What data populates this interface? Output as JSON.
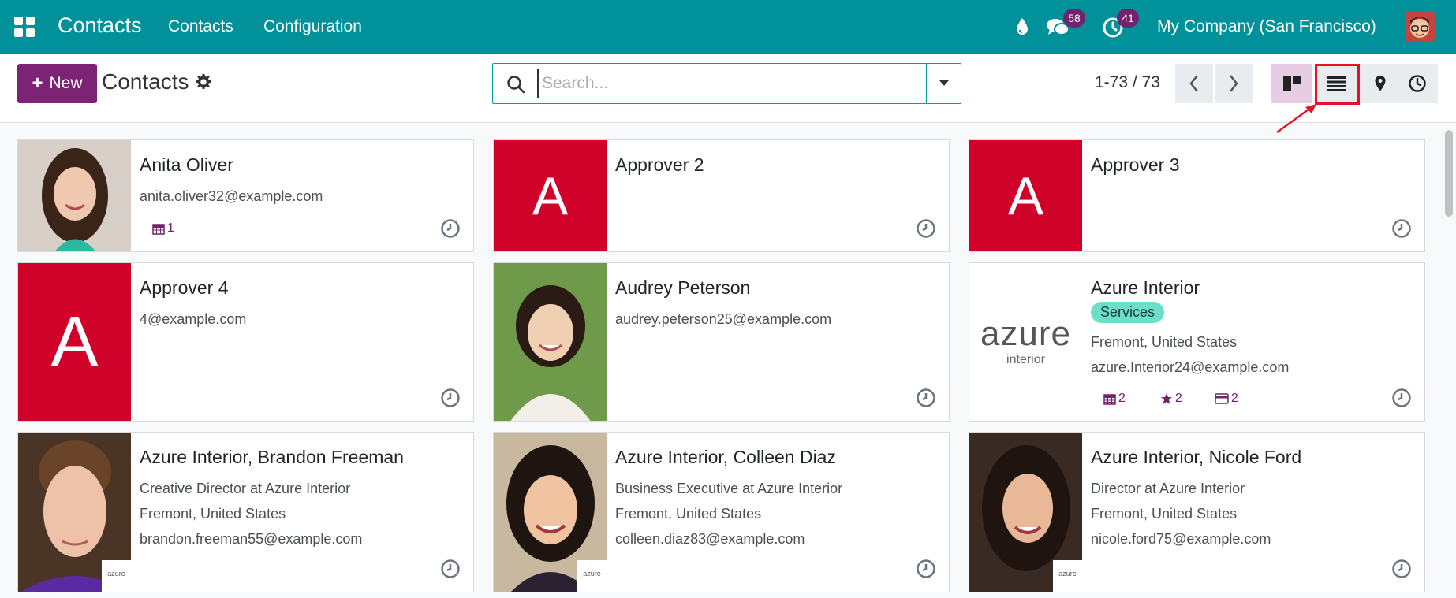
{
  "navbar": {
    "brand": "Contacts",
    "menu": [
      "Contacts",
      "Configuration"
    ],
    "messages_badge": "58",
    "activities_badge": "41",
    "company": "My Company (San Francisco)",
    "color": "#00919a"
  },
  "control": {
    "new_label": "New",
    "title": "Contacts",
    "search_placeholder": "Search...",
    "pager": "1-73 / 73",
    "views": [
      "kanban",
      "list",
      "map",
      "activity"
    ],
    "active_view": "kanban",
    "highlighted_view": "list"
  },
  "cards": [
    {
      "name": "Anita Oliver",
      "lines": [
        "anita.oliver32@example.com"
      ],
      "meetings": "1"
    },
    {
      "name": "Approver 2",
      "letter": "A",
      "lines": []
    },
    {
      "name": "Approver 3",
      "letter": "A",
      "lines": []
    },
    {
      "name": "Approver 4",
      "letter": "A",
      "lines": [
        "4@example.com"
      ]
    },
    {
      "name": "Audrey Peterson",
      "lines": [
        "audrey.peterson25@example.com"
      ]
    },
    {
      "name": "Azure Interior",
      "tag": "Services",
      "lines": [
        "Fremont, United States",
        "azure.Interior24@example.com"
      ],
      "logo_text": "azure",
      "logo_sub": "interior",
      "meetings": "2",
      "opportunities": "2",
      "invoices": "2"
    },
    {
      "name": "Azure Interior, Brandon Freeman",
      "lines": [
        "Creative Director at Azure Interior",
        "Fremont, United States",
        "brandon.freeman55@example.com"
      ],
      "company_logo": "azure"
    },
    {
      "name": "Azure Interior, Colleen Diaz",
      "lines": [
        "Business Executive at Azure Interior",
        "Fremont, United States",
        "colleen.diaz83@example.com"
      ],
      "company_logo": "azure"
    },
    {
      "name": "Azure Interior, Nicole Ford",
      "lines": [
        "Director at Azure Interior",
        "Fremont, United States",
        "nicole.ford75@example.com"
      ],
      "company_logo": "azure"
    }
  ]
}
